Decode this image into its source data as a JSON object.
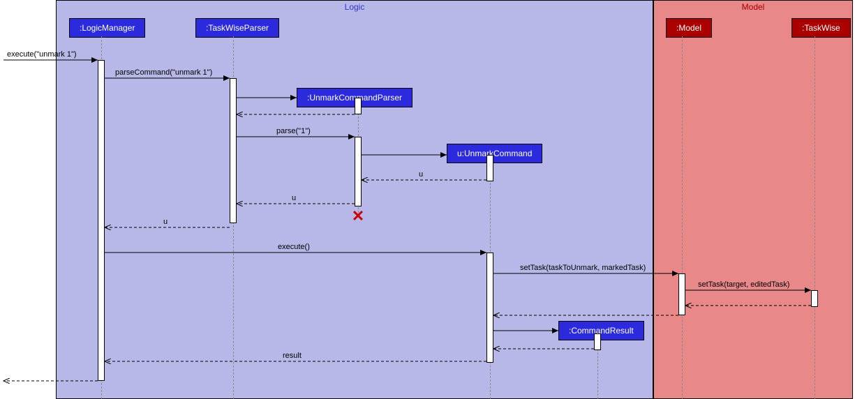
{
  "frames": {
    "logic": {
      "label": "Logic",
      "bg": "#b8b8e8",
      "labelColor": "#3333cc"
    },
    "model": {
      "label": "Model",
      "bg": "#e88888",
      "labelColor": "#aa0000"
    }
  },
  "participants": {
    "logicManager": {
      "label": ":LogicManager",
      "bg": "#2b2bdd"
    },
    "taskWiseParser": {
      "label": ":TaskWiseParser",
      "bg": "#2b2bdd"
    },
    "unmarkCommandParser": {
      "label": ":UnmarkCommandParser",
      "bg": "#2b2bdd"
    },
    "unmarkCommand": {
      "label": "u:UnmarkCommand",
      "bg": "#2b2bdd"
    },
    "commandResult": {
      "label": ":CommandResult",
      "bg": "#2b2bdd"
    },
    "modelP": {
      "label": ":Model",
      "bg": "#aa0000"
    },
    "taskWise": {
      "label": ":TaskWise",
      "bg": "#aa0000"
    }
  },
  "messages": {
    "execute1": "execute(\"unmark 1\")",
    "parseCommand": "parseCommand(\"unmark 1\")",
    "parse1": "parse(\"1\")",
    "returnU1": "u",
    "returnU2": "u",
    "returnU3": "u",
    "execute2": "execute()",
    "setTask1": "setTask(taskToUnmark, markedTask)",
    "setTask2": "setTask(target, editedTask)",
    "result": "result"
  },
  "colors": {
    "logicFrameBg": "#b8b8e8",
    "modelFrameBg": "#e88888",
    "logicBox": "#2b2bdd",
    "modelBox": "#aa0000"
  }
}
